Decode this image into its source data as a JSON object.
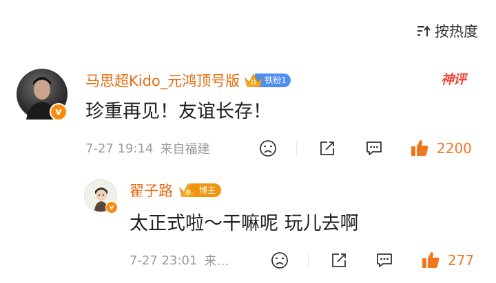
{
  "sort": {
    "label": "按热度"
  },
  "comment": {
    "username": "马思超Kido_元鸿顶号版",
    "fan_badge_label": "铁粉1",
    "god_tag": "神评",
    "text": "珍重再见！友谊长存！",
    "date": "7-27 19:14",
    "location": "来自福建",
    "like_count": "2200"
  },
  "reply": {
    "username": "翟子路",
    "host_badge_label": "博主",
    "text": "太正式啦～干嘛呢 玩儿去啊",
    "date": "7-27 23:01",
    "location": "来…",
    "like_count": "277"
  },
  "colors": {
    "username": "#e86b0f",
    "like": "#f2761e",
    "verified": "#fe8a0d",
    "fan_badge": "#4d8ef0",
    "host_badge": "#f29513"
  },
  "icons": [
    "sort-icon",
    "crown-icon",
    "verified-icon",
    "dislike-face-icon",
    "share-icon",
    "comment-icon",
    "like-thumb-icon"
  ]
}
